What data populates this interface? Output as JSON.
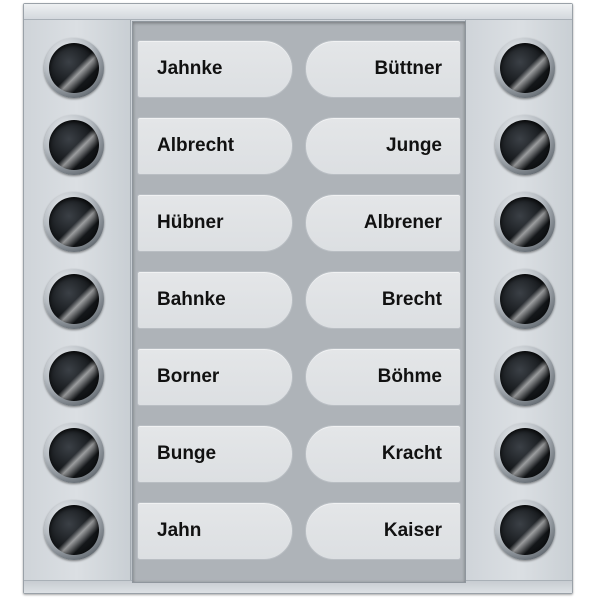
{
  "nameplate": {
    "left_names": [
      "Jahnke",
      "Albrecht",
      "Hübner",
      "Bahnke",
      "Borner",
      "Bunge",
      "Jahn"
    ],
    "right_names": [
      "Büttner",
      "Junge",
      "Albrener",
      "Brecht",
      "Böhme",
      "Kracht",
      "Kaiser"
    ]
  },
  "colors": {
    "panel": "#c6ccd2",
    "label_slot": "#e0e2e5",
    "label_text": "#111111",
    "button_cap": "#15181b"
  },
  "icons": {
    "call_button": "bell-push-button-icon"
  }
}
